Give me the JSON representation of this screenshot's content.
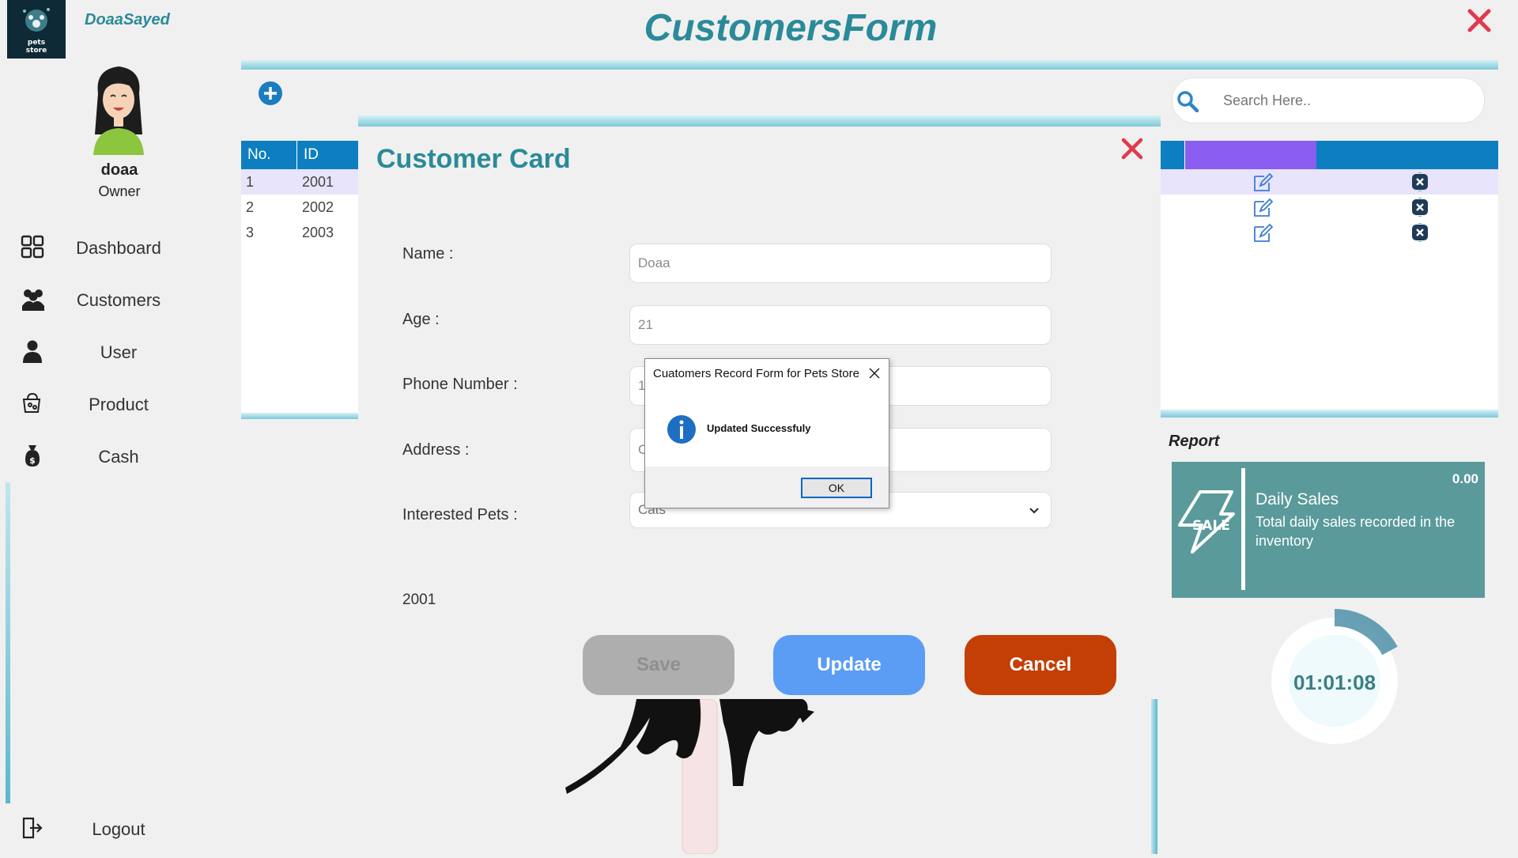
{
  "app": {
    "title": "CustomersForm",
    "brand": "DoaaSayed",
    "logo_text": "pets store"
  },
  "user": {
    "name": "doaa",
    "role": "Owner"
  },
  "nav": {
    "items": [
      {
        "label": "Dashboard",
        "icon": "dashboard-grid-icon"
      },
      {
        "label": "Customers",
        "icon": "customers-icon"
      },
      {
        "label": "User",
        "icon": "user-icon"
      },
      {
        "label": "Product",
        "icon": "product-icon"
      },
      {
        "label": "Cash",
        "icon": "money-bag-icon"
      }
    ],
    "logout": "Logout"
  },
  "search": {
    "placeholder": "Search Here.."
  },
  "table_left": {
    "headers": [
      "No.",
      "ID"
    ],
    "rows": [
      {
        "no": "1",
        "id": "2001"
      },
      {
        "no": "2",
        "id": "2002"
      },
      {
        "no": "3",
        "id": "2003"
      }
    ]
  },
  "table_right": {
    "row_count": 3,
    "actions": [
      "edit-icon",
      "delete-icon"
    ]
  },
  "card": {
    "title": "Customer Card",
    "fields": {
      "name_label": "Name :",
      "name_value": "Doaa",
      "age_label": "Age :",
      "age_value": "21",
      "phone_label": "Phone Number :",
      "phone_value": "1",
      "address_label": "Address :",
      "address_value": "C",
      "pets_label": "Interested Pets :",
      "pets_value": "Cats"
    },
    "record_id": "2001",
    "buttons": {
      "save": "Save",
      "update": "Update",
      "cancel": "Cancel"
    }
  },
  "dialog": {
    "title": "Cuatomers Record Form for Pets Store",
    "message": "Updated Successfuly",
    "ok": "OK"
  },
  "report": {
    "label": "Report",
    "sales_title": "Daily Sales",
    "sales_desc": "Total daily sales recorded in the inventory",
    "sales_amount": "0.00",
    "sale_badge": "SALE",
    "timer": "01:01:08"
  },
  "colors": {
    "accent": "#2a8a99",
    "header_blue": "#0d7fc0",
    "purple": "#8a5cf0",
    "update": "#5b9cf5",
    "cancel": "#c43f06",
    "close_red": "#e03a4c",
    "sales_card": "#5a9a9b"
  }
}
